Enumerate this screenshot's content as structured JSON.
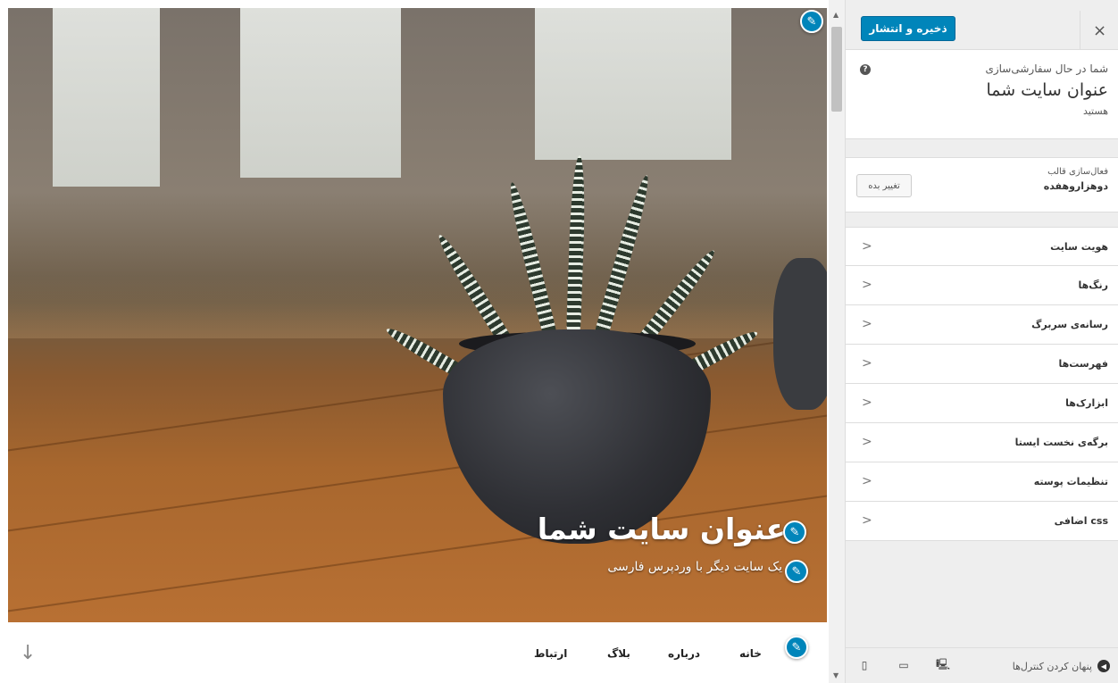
{
  "preview": {
    "site_title": "عنوان سایت شما",
    "tagline": "یک سایت دیگر با وردپرس فارسی",
    "nav": [
      "خانه",
      "درباره",
      "بلاگ",
      "ارتباط"
    ]
  },
  "sidebar": {
    "publish_label": "ذخیره و انتشار",
    "close_glyph": "×",
    "info_pre": "شما در حال سفارشی‌سازی",
    "info_title": "عنوان سایت شما",
    "info_post": "هستید",
    "theme_label": "فعال‌سازی قالب",
    "theme_name": "دوهزاروهفده",
    "change_label": "تغییر بده",
    "menu": [
      "هویت سایت",
      "رنگ‌ها",
      "رسانه‌ی سربرگ",
      "فهرست‌ها",
      "ابزارک‌ها",
      "برگه‌ی نخست ایستا",
      "تنظیمات پوسته",
      "css اضافی"
    ],
    "hide_controls": "پنهان کردن کنترل‌ها"
  },
  "colors": {
    "accent": "#0085ba",
    "sidebar_bg": "#eeeeee"
  },
  "icons": [
    "close-icon",
    "help-icon",
    "pencil-icon",
    "chevron-left-icon",
    "arrow-down-icon",
    "desktop-icon",
    "tablet-icon",
    "mobile-icon"
  ]
}
